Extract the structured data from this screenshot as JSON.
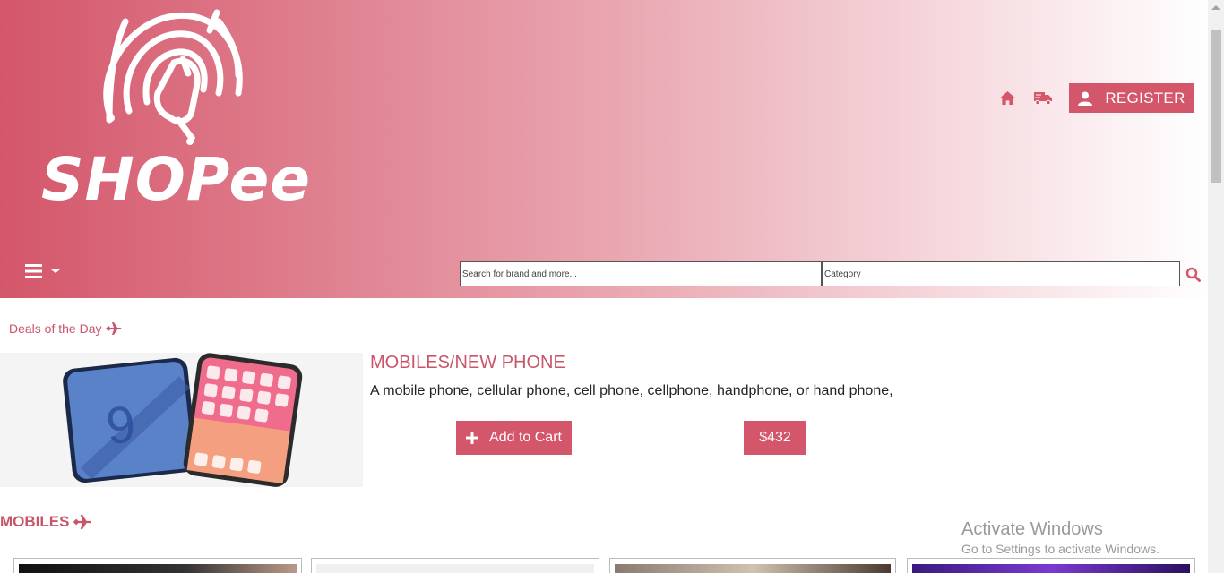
{
  "brand": {
    "name": "SHOPee"
  },
  "header": {
    "register_label": "REGISTER",
    "search_placeholder": "Search for brand and more...",
    "category_placeholder": "Category"
  },
  "deals": {
    "label": "Deals of the Day",
    "product": {
      "title": "MOBILES/NEW PHONE",
      "description": "A mobile phone, cellular phone, cell phone, cellphone, handphone, or hand phone,",
      "add_to_cart_label": "Add to Cart",
      "price": "$432"
    }
  },
  "section": {
    "title": "MOBILES"
  },
  "watermark": {
    "title": "Activate Windows",
    "subtitle": "Go to Settings to activate Windows."
  },
  "colors": {
    "accent": "#d4566a",
    "accent_text": "#c9556a"
  },
  "icons": [
    "home-icon",
    "truck-icon",
    "user-icon",
    "bars-icon",
    "caret-down-icon",
    "search-icon",
    "plane-icon",
    "plus-icon"
  ]
}
